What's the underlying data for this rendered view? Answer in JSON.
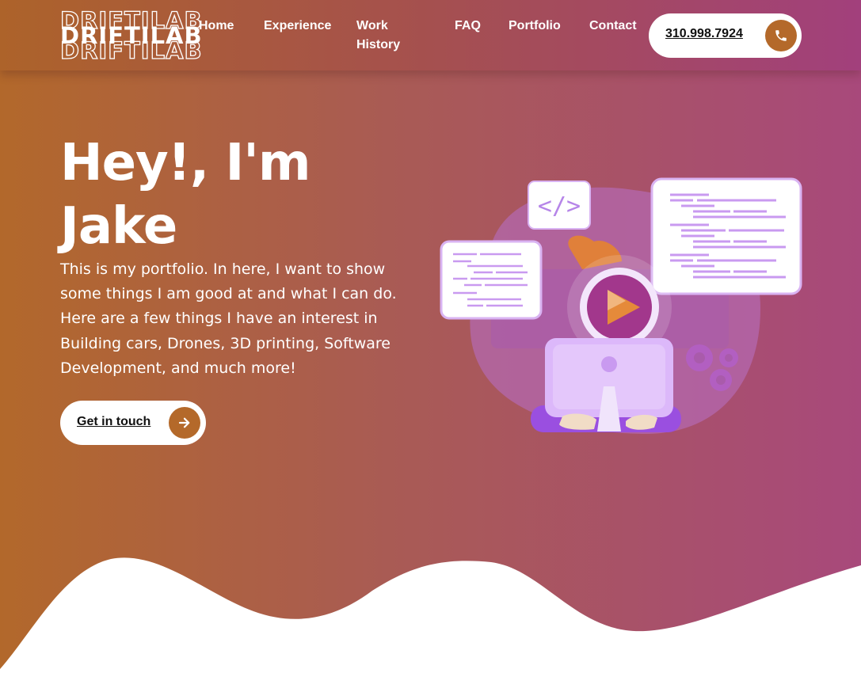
{
  "brand": {
    "logo_text": "DRIFTILAB"
  },
  "nav": {
    "home": "Home",
    "experience": "Experience",
    "work_history_line1": "Work",
    "work_history_line2": "History",
    "faq": "FAQ",
    "portfolio": "Portfolio",
    "contact": "Contact"
  },
  "phone": {
    "number": "310.998.7924",
    "icon": "phone-icon"
  },
  "hero": {
    "title_line1": "Hey!, I'm",
    "title_line2": "Jake",
    "text": "This is my portfolio. In here, I want to show some things I am good at and what I can do. Here are a few things I have an interest in Building cars, Drones, 3D printing, Software Development, and much more!",
    "cta_label": "Get in touch",
    "cta_icon": "arrow-right-icon"
  },
  "illustration": {
    "code_tag": "</>"
  },
  "colors": {
    "accent": "#b4692a",
    "purple": "#a8497b",
    "illustration_purple": "#c99af0"
  }
}
